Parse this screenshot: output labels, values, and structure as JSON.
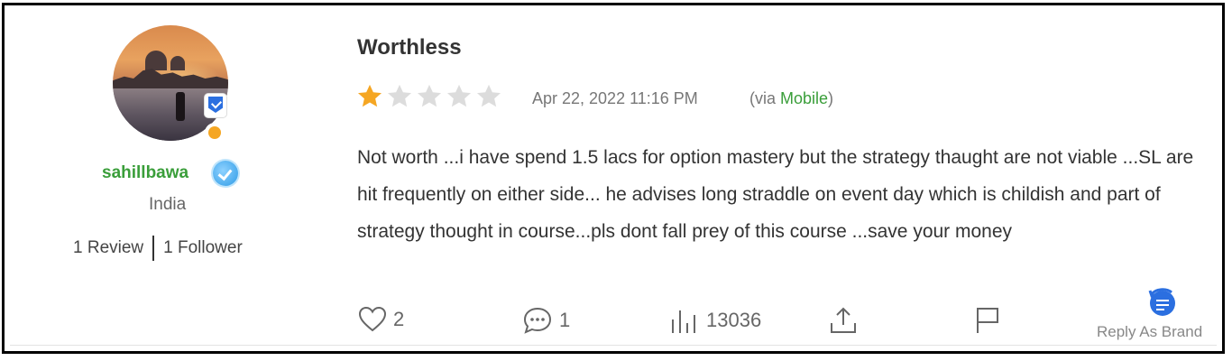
{
  "reviewer": {
    "username": "sahillbawa",
    "country": "India",
    "reviews": "1 Review",
    "followers": "1 Follower"
  },
  "review": {
    "title": "Worthless",
    "rating": 1,
    "rating_max": 5,
    "date": "Apr 22, 2022 11:16 PM",
    "via_prefix": "(via ",
    "via_source": "Mobile",
    "via_suffix": ")",
    "text": "Not worth ...i have spend 1.5 lacs for option mastery but the strategy thaught are not viable ...SL are hit frequently on either side... he advises long straddle on event day which is childish and part of strategy thought in course...pls dont fall prey of this course ...save your money"
  },
  "actions": {
    "likes": "2",
    "comments": "1",
    "views": "13036",
    "reply_as_brand": "Reply As Brand"
  },
  "colors": {
    "accent_green": "#3a9e3a",
    "star_filled": "#f5a623",
    "star_empty": "#dcdcdc",
    "brand_blue": "#2b6fe0"
  },
  "icons": [
    "heart-icon",
    "comment-icon",
    "views-chart-icon",
    "share-icon",
    "flag-icon",
    "reply-brand-icon",
    "verified-icon",
    "shield-icon"
  ]
}
